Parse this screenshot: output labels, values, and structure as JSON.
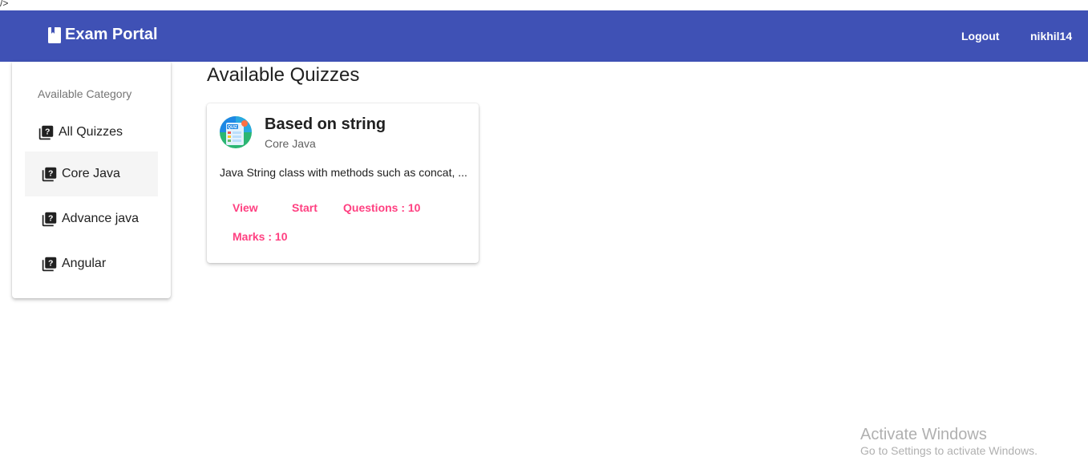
{
  "stray_text": "/>",
  "toolbar": {
    "title": "Exam Portal",
    "logout_label": "Logout",
    "username": "nikhil14",
    "color": "#3f51b5",
    "icon": "book-icon"
  },
  "sidebar": {
    "header": "Available Category",
    "items": [
      {
        "label": "All Quizzes",
        "icon": "quiz-icon",
        "active": false
      },
      {
        "label": "Core Java",
        "icon": "quiz-icon",
        "active": true
      },
      {
        "label": "Advance java",
        "icon": "quiz-icon",
        "active": false
      },
      {
        "label": "Angular",
        "icon": "quiz-icon",
        "active": false
      }
    ]
  },
  "main": {
    "title": "Available Quizzes",
    "quizzes": [
      {
        "title": "Based on string",
        "category": "Core Java",
        "description": "Java String class with methods such as concat, ...",
        "view_label": "View",
        "start_label": "Start",
        "questions_label": "Questions : 10",
        "marks_label": "Marks : 10",
        "avatar_icon": "quiz-logo-icon",
        "accent": "#ff4081"
      }
    ]
  },
  "watermark": {
    "line1": "Activate Windows",
    "line2": "Go to Settings to activate Windows."
  }
}
